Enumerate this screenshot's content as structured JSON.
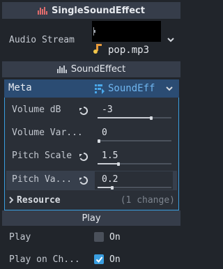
{
  "inspector": {
    "title": "SingleSoundEffect",
    "audio_stream_label": "Audio Stream",
    "audio_file": "pop.mp3",
    "sound_effect_section": "SoundEffect",
    "meta_label": "Meta",
    "meta_value": "SoundEff",
    "properties": [
      {
        "label": "Volume dB",
        "value": "-3",
        "level": 0.73
      },
      {
        "label": "Volume Var...",
        "value": "0",
        "level": 0.0
      },
      {
        "label": "Pitch Scale",
        "value": "1.5",
        "level": 0.28
      },
      {
        "label": "Pitch Va...",
        "value": "0.2",
        "level": 0.2
      }
    ],
    "resource_label": "Resource",
    "resource_changes": "(1 change)",
    "play_section": "Play",
    "play_label": "Play",
    "play_value": "On",
    "play_checked": false,
    "play_on_change_label": "Play on Ch...",
    "play_on_change_value": "On",
    "play_on_change_checked": true
  },
  "colors": {
    "accent": "#3a9ee0",
    "meta_bg": "#2b4c73",
    "header_bg": "#363d4a",
    "panel_bg": "#21252b",
    "group_bg": "#2a2f37",
    "audio_icon_orange": "#e89a3a"
  },
  "icons": [
    "grip-icon",
    "audio-file-icon",
    "reset-icon",
    "dropdown-chevron-icon",
    "script-icon",
    "checkmark-icon",
    "expand-arrow-icon"
  ]
}
